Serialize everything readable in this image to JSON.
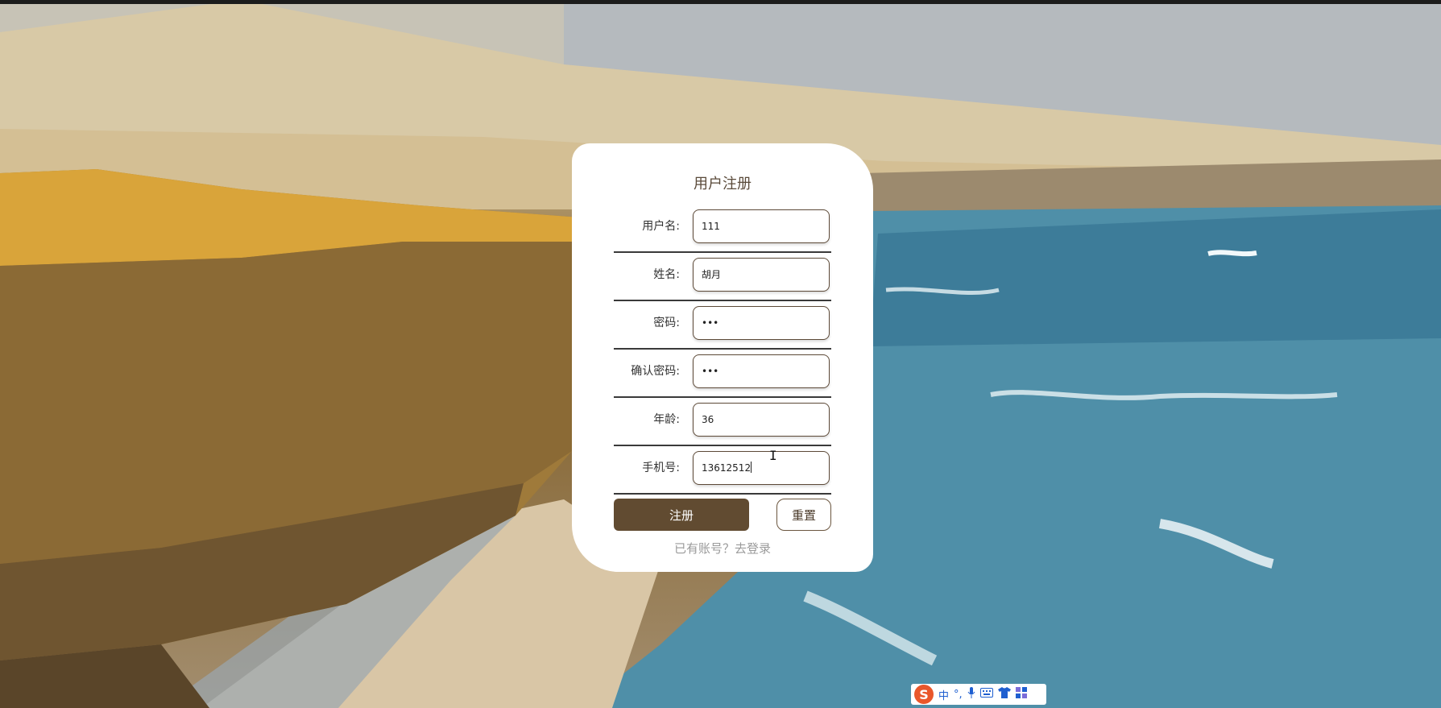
{
  "form": {
    "title": "用户注册",
    "fields": [
      {
        "label": "用户名:",
        "value": "111"
      },
      {
        "label": "姓名:",
        "value": "胡月"
      },
      {
        "label": "密码:",
        "value": "•••"
      },
      {
        "label": "确认密码:",
        "value": "•••"
      },
      {
        "label": "年龄:",
        "value": "36"
      },
      {
        "label": "手机号:",
        "value": "13612512"
      }
    ],
    "submit_label": "注册",
    "reset_label": "重置",
    "login_link": "已有账号？去登录"
  },
  "ime": {
    "logo": "S",
    "mode": "中",
    "punct": "°,",
    "icons": [
      "microphone-icon",
      "keyboard-icon",
      "shirt-icon",
      "apps-icon"
    ]
  }
}
